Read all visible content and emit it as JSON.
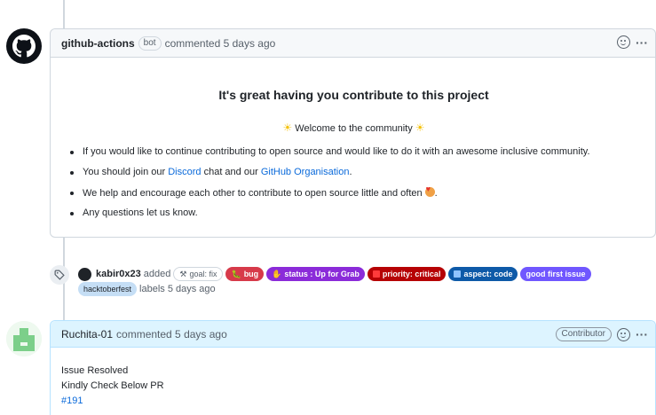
{
  "comment1": {
    "author": "github-actions",
    "bot_badge": "bot",
    "meta": "commented 5 days ago",
    "title": "It's great having you contribute to this project",
    "welcome": "Welcome to the community",
    "items": [
      {
        "text": "If you would like to continue contributing to open source and would like to do it with an awesome inclusive community."
      },
      {
        "pre": "You should join our ",
        "link1": "Discord",
        "mid": " chat and our ",
        "link2": "GitHub Organisation",
        "post": "."
      },
      {
        "pre": "We help and encourage each other to contribute to open source little and often ",
        "post": "."
      },
      {
        "text": "Any questions let us know."
      }
    ]
  },
  "labels_event": {
    "actor": "kabir0x23",
    "verb": "added",
    "labels": [
      {
        "text": "goal: fix",
        "bg": "#ffffff",
        "fg": "#57606a",
        "border": "#d0d7de",
        "icon": "tools-icon"
      },
      {
        "text": "bug",
        "bg": "#d73a4a",
        "fg": "#ffffff",
        "icon": "bug-icon"
      },
      {
        "text": "status : Up for Grab",
        "bg": "#8b2bd9",
        "fg": "#ffffff",
        "icon": "hand-icon"
      },
      {
        "text": "priority: critical",
        "bg": "#b60205",
        "fg": "#ffffff",
        "icon": "square-icon"
      },
      {
        "text": "aspect: code",
        "bg": "#0e5aa8",
        "fg": "#ffffff",
        "icon": "code-icon"
      },
      {
        "text": "good first issue",
        "bg": "#7057ff",
        "fg": "#ffffff",
        "icon": ""
      },
      {
        "text": "hacktoberfest",
        "bg": "#c5def5",
        "fg": "#1f2328",
        "icon": ""
      }
    ],
    "suffix": "labels 5 days ago"
  },
  "comment2": {
    "author": "Ruchita-01",
    "meta": "commented 5 days ago",
    "badge": "Contributor",
    "lines": [
      "Issue Resolved",
      "Kindly Check Below PR"
    ],
    "link": "#191"
  }
}
